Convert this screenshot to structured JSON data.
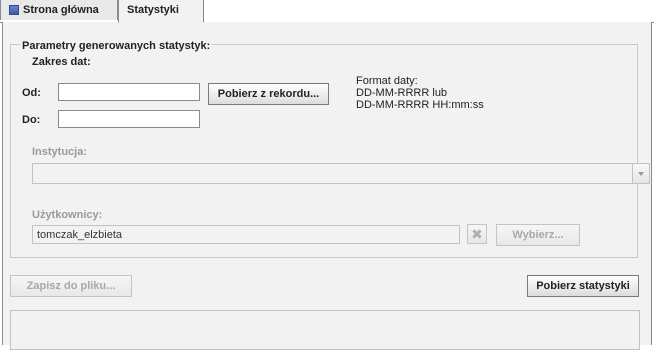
{
  "tabs": [
    {
      "label": "Strona główna"
    },
    {
      "label": "Statystyki"
    }
  ],
  "params": {
    "legend": "Parametry generowanych statystyk:",
    "date_range_label": "Zakres dat:",
    "from_label": "Od:",
    "to_label": "Do:",
    "from_value": "",
    "to_value": "",
    "fetch_from_record_label": "Pobierz z rekordu...",
    "format_lines": [
      "Format daty:",
      "DD-MM-RRRR lub",
      "DD-MM-RRRR HH:mm:ss"
    ],
    "institution_label": "Instytucja:",
    "institution_value": "",
    "users_label": "Użytkownicy:",
    "users_value": "tomczak_elzbieta",
    "clear_icon_glyph": "✖",
    "choose_label": "Wybierz..."
  },
  "actions": {
    "save_label": "Zapisz do pliku...",
    "fetch_stats_label": "Pobierz statystyki"
  }
}
